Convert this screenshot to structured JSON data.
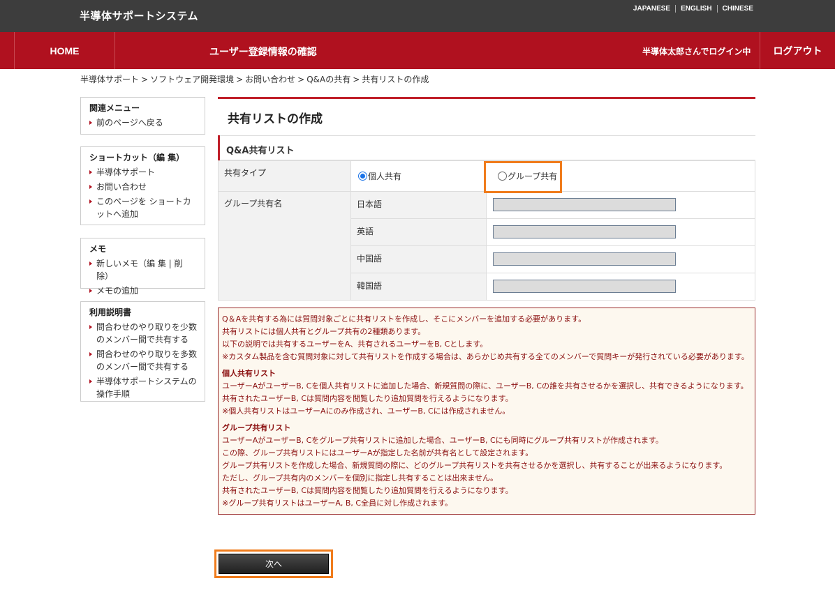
{
  "header": {
    "site_title": "半導体サポートシステム",
    "languages": [
      "JAPANESE",
      "ENGLISH",
      "CHINESE"
    ]
  },
  "nav": {
    "home": "HOME",
    "title": "ユーザー登録情報の確認",
    "user_status": "半導体太郎さんでログイン中",
    "logout": "ログアウト"
  },
  "breadcrumb": [
    "半導体サポート",
    "ソフトウェア開発環境",
    "お問い合わせ",
    "Q&Aの共有",
    "共有リストの作成"
  ],
  "sidebar": {
    "related": {
      "title": "関連メニュー",
      "items": [
        "前のページへ戻る"
      ]
    },
    "shortcut": {
      "title": "ショートカット（編 集）",
      "items": [
        "半導体サポート",
        "お問い合わせ",
        "このページを ショートカットへ追加"
      ]
    },
    "memo": {
      "title": "メモ",
      "items": [
        "新しいメモ（編 集 | 削 除）",
        "メモの追加"
      ]
    },
    "guide": {
      "title": "利用説明書",
      "items": [
        "問合わせのやり取りを少数のメンバー間で共有する",
        "問合わせのやり取りを多数のメンバー間で共有する",
        "半導体サポートシステムの操作手順"
      ]
    }
  },
  "main": {
    "page_title": "共有リストの作成",
    "section_title": "Q&A共有リスト",
    "share_type_label": "共有タイプ",
    "radio_personal": "個人共有",
    "radio_group": "グループ共有",
    "selected": "個人共有",
    "group_name_label": "グループ共有名",
    "languages": [
      "日本語",
      "英語",
      "中国語",
      "韓国語"
    ],
    "next_button": "次へ"
  },
  "notes": {
    "intro": [
      "Q＆Aを共有する為には質問対象ごとに共有リストを作成し、そこにメンバーを追加する必要があります。",
      "共有リストには個人共有とグループ共有の2種類あります。",
      "以下の説明では共有するユーザーをA、共有されるユーザーをB, Cとします。",
      "※カスタム製品を含む質問対象に対して共有リストを作成する場合は、あらかじめ共有する全てのメンバーで質問キーが発行されている必要があります。"
    ],
    "personal_title": "個人共有リスト",
    "personal": [
      "ユーザーAがユーザーB, Cを個人共有リストに追加した場合、新規質問の際に、ユーザーB, Cの誰を共有させるかを選択し、共有できるようになります。",
      "共有されたユーザーB, Cは質問内容を閲覧したり追加質問を行えるようになります。",
      "※個人共有リストはユーザーAにのみ作成され、ユーザーB, Cには作成されません。"
    ],
    "group_title": "グループ共有リスト",
    "group": [
      "ユーザーAがユーザーB, Cをグループ共有リストに追加した場合、ユーザーB, Cにも同時にグループ共有リストが作成されます。",
      "この際、グループ共有リストにはユーザーAが指定した名前が共有名として設定されます。",
      "グループ共有リストを作成した場合、新規質問の際に、どのグループ共有リストを共有させるかを選択し、共有することが出来るようになります。",
      "ただし、グループ共有内のメンバーを個別に指定し共有することは出来ません。",
      "共有されたユーザーB, Cは質問内容を閲覧したり追加質問を行えるようになります。",
      "※グループ共有リストはユーザーA, B, C全員に対し作成されます。"
    ]
  },
  "colors": {
    "nav_red": "#b0111f",
    "topbar": "#3d3d3d",
    "highlight": "#f07c1c",
    "note_text": "#8b1010"
  }
}
